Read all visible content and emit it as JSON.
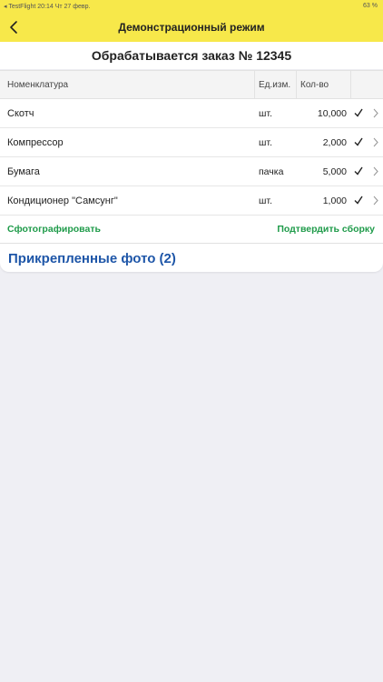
{
  "status_bar": {
    "left": "◂ TestFlight 20:14  Чт 27 февр.",
    "right": "63 %"
  },
  "nav": {
    "title": "Демонстрационный режим"
  },
  "order": {
    "title": "Обрабатывается заказ № 12345"
  },
  "table": {
    "headers": {
      "name": "Номенклатура",
      "unit": "Ед.изм.",
      "qty": "Кол-во"
    },
    "rows": [
      {
        "name": "Скотч",
        "unit": "шт.",
        "qty": "10,000",
        "checked": true
      },
      {
        "name": "Компрессор",
        "unit": "шт.",
        "qty": "2,000",
        "checked": true
      },
      {
        "name": "Бумага",
        "unit": "пачка",
        "qty": "5,000",
        "checked": true
      },
      {
        "name": "Кондиционер \"Самсунг\"",
        "unit": "шт.",
        "qty": "1,000",
        "checked": true
      }
    ]
  },
  "actions": {
    "photograph": "Сфотографировать",
    "confirm": "Подтвердить сборку"
  },
  "photos": {
    "title": "Прикрепленные фото (2)"
  },
  "colors": {
    "nav_background": "#f7e84a",
    "action_green": "#1f9b4a",
    "section_blue": "#1e56a8",
    "page_background": "#efeff4"
  }
}
